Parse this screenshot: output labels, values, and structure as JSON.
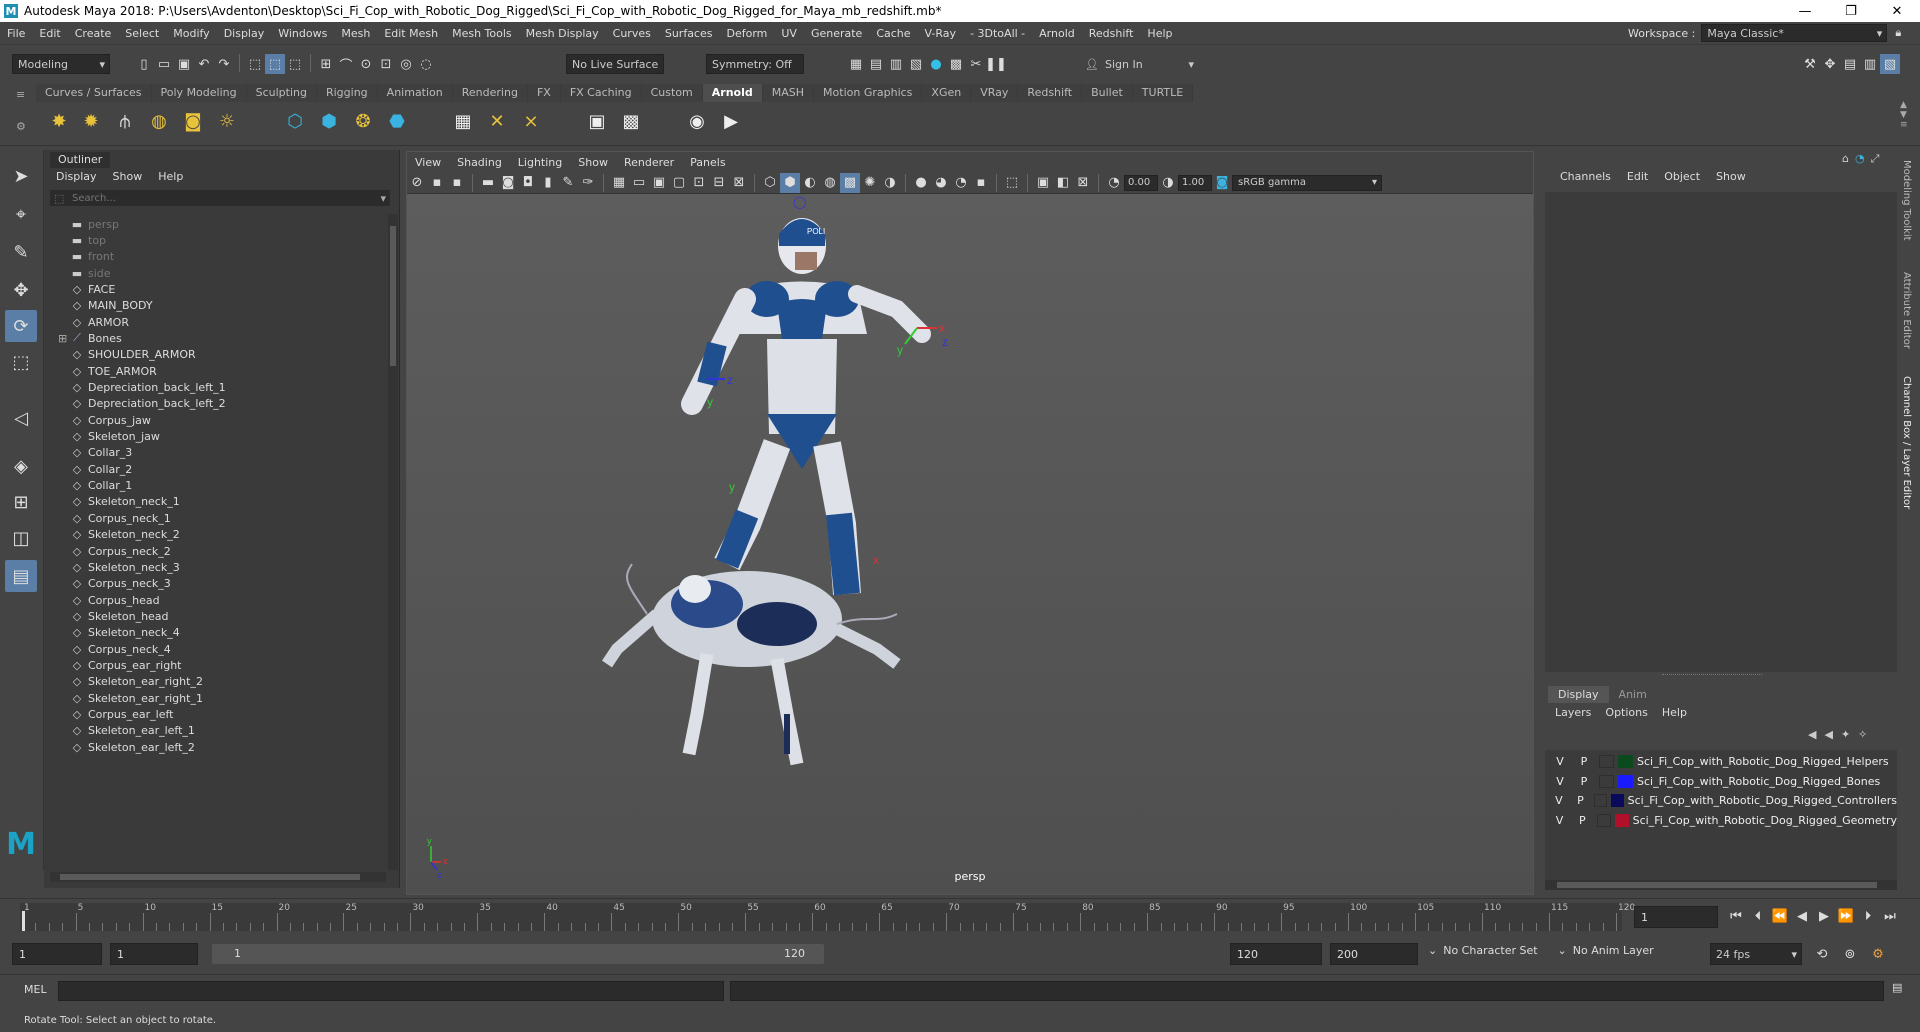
{
  "titlebar": {
    "title": "Autodesk Maya 2018: P:\\Users\\Avdenton\\Desktop\\Sci_Fi_Cop_with_Robotic_Dog_Rigged\\Sci_Fi_Cop_with_Robotic_Dog_Rigged_for_Maya_mb_redshift.mb*"
  },
  "menubar": {
    "items": [
      "File",
      "Edit",
      "Create",
      "Select",
      "Modify",
      "Display",
      "Windows",
      "Mesh",
      "Edit Mesh",
      "Mesh Tools",
      "Mesh Display",
      "Curves",
      "Surfaces",
      "Deform",
      "UV",
      "Generate",
      "Cache",
      "V-Ray",
      "- 3DtoAll -",
      "Arnold",
      "Redshift",
      "Help"
    ],
    "workspace_label": "Workspace :",
    "workspace_value": "Maya Classic*"
  },
  "statusline": {
    "mode": "Modeling",
    "live_surface": "No Live Surface",
    "symmetry": "Symmetry: Off",
    "sign_in": "Sign In"
  },
  "shelf": {
    "tabs": [
      "Curves / Surfaces",
      "Poly Modeling",
      "Sculpting",
      "Rigging",
      "Animation",
      "Rendering",
      "FX",
      "FX Caching",
      "Custom",
      "Arnold",
      "MASH",
      "Motion Graphics",
      "XGen",
      "VRay",
      "Redshift",
      "Bullet",
      "TURTLE"
    ],
    "active_tab": "Arnold"
  },
  "outliner": {
    "title": "Outliner",
    "menu": [
      "Display",
      "Show",
      "Help"
    ],
    "search_placeholder": "Search...",
    "items": [
      {
        "label": "persp",
        "type": "camera",
        "dim": true
      },
      {
        "label": "top",
        "type": "camera",
        "dim": true
      },
      {
        "label": "front",
        "type": "camera",
        "dim": true
      },
      {
        "label": "side",
        "type": "camera",
        "dim": true
      },
      {
        "label": "FACE",
        "type": "mesh"
      },
      {
        "label": "MAIN_BODY",
        "type": "mesh"
      },
      {
        "label": "ARMOR",
        "type": "mesh"
      },
      {
        "label": "Bones",
        "type": "joint",
        "expand": "⊞"
      },
      {
        "label": "SHOULDER_ARMOR",
        "type": "mesh"
      },
      {
        "label": "TOE_ARMOR",
        "type": "mesh"
      },
      {
        "label": "Depreciation_back_left_1",
        "type": "mesh"
      },
      {
        "label": "Depreciation_back_left_2",
        "type": "mesh"
      },
      {
        "label": "Corpus_jaw",
        "type": "mesh"
      },
      {
        "label": "Skeleton_jaw",
        "type": "mesh"
      },
      {
        "label": "Collar_3",
        "type": "mesh"
      },
      {
        "label": "Collar_2",
        "type": "mesh"
      },
      {
        "label": "Collar_1",
        "type": "mesh"
      },
      {
        "label": "Skeleton_neck_1",
        "type": "mesh"
      },
      {
        "label": "Corpus_neck_1",
        "type": "mesh"
      },
      {
        "label": "Skeleton_neck_2",
        "type": "mesh"
      },
      {
        "label": "Corpus_neck_2",
        "type": "mesh"
      },
      {
        "label": "Skeleton_neck_3",
        "type": "mesh"
      },
      {
        "label": "Corpus_neck_3",
        "type": "mesh"
      },
      {
        "label": "Corpus_head",
        "type": "mesh"
      },
      {
        "label": "Skeleton_head",
        "type": "mesh"
      },
      {
        "label": "Skeleton_neck_4",
        "type": "mesh"
      },
      {
        "label": "Corpus_neck_4",
        "type": "mesh"
      },
      {
        "label": "Corpus_ear_right",
        "type": "mesh"
      },
      {
        "label": "Skeleton_ear_right_2",
        "type": "mesh"
      },
      {
        "label": "Skeleton_ear_right_1",
        "type": "mesh"
      },
      {
        "label": "Corpus_ear_left",
        "type": "mesh"
      },
      {
        "label": "Skeleton_ear_left_1",
        "type": "mesh"
      },
      {
        "label": "Skeleton_ear_left_2",
        "type": "mesh"
      }
    ]
  },
  "viewport": {
    "menu": [
      "View",
      "Shading",
      "Lighting",
      "Show",
      "Renderer",
      "Panels"
    ],
    "exposure": "0.00",
    "gamma": "1.00",
    "color_space": "sRGB gamma",
    "camera_label": "persp",
    "axis": {
      "x": "x",
      "y": "y",
      "z": "z"
    },
    "helmet_text": "POLI"
  },
  "channelbox": {
    "menu": [
      "Channels",
      "Edit",
      "Object",
      "Show"
    ],
    "layer_tabs": [
      "Display",
      "Anim"
    ],
    "active_layer_tab": "Display",
    "layer_menu": [
      "Layers",
      "Options",
      "Help"
    ],
    "layers": [
      {
        "v": "V",
        "p": "P",
        "color": "#0b4a1e",
        "name": "Sci_Fi_Cop_with_Robotic_Dog_Rigged_Helpers"
      },
      {
        "v": "V",
        "p": "P",
        "color": "#1a1aff",
        "name": "Sci_Fi_Cop_with_Robotic_Dog_Rigged_Bones"
      },
      {
        "v": "V",
        "p": "P",
        "color": "#0a0a5a",
        "name": "Sci_Fi_Cop_with_Robotic_Dog_Rigged_Controllers"
      },
      {
        "v": "V",
        "p": "P",
        "color": "#b0102a",
        "name": "Sci_Fi_Cop_with_Robotic_Dog_Rigged_Geometry"
      }
    ],
    "side_tabs": [
      "Modeling Toolkit",
      "Attribute Editor",
      "Channel Box / Layer Editor"
    ]
  },
  "timeslider": {
    "ticks": [
      "1",
      "5",
      "10",
      "15",
      "20",
      "25",
      "30",
      "35",
      "40",
      "45",
      "50",
      "55",
      "60",
      "65",
      "70",
      "75",
      "80",
      "85",
      "90",
      "95",
      "100",
      "105",
      "110",
      "115",
      "120"
    ],
    "current_frame": "1"
  },
  "range": {
    "start": "1",
    "anim_start": "1",
    "range_start": "1",
    "range_end": "120",
    "end": "120",
    "anim_end": "200",
    "character_set": "No Character Set",
    "anim_layer": "No Anim Layer",
    "fps": "24 fps"
  },
  "cmdline": {
    "label": "MEL"
  },
  "helpline": {
    "text": "Rotate Tool: Select an object to rotate."
  }
}
